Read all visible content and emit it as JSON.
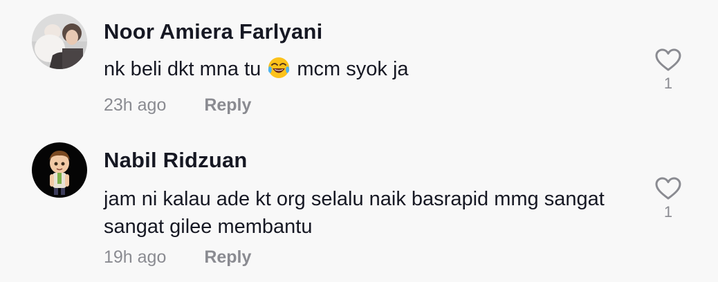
{
  "comments": [
    {
      "username": "Noor Amiera Farlyani",
      "text_before_emoji": "nk beli dkt mna tu ",
      "emoji_icon": "face-with-tears-of-joy-icon",
      "text_after_emoji": "  mcm syok ja",
      "time": "23h ago",
      "reply_label": "Reply",
      "likes": "1"
    },
    {
      "username": "Nabil Ridzuan",
      "text": "jam ni kalau ade kt org selalu naik basrapid mmg sangat sangat gilee membantu",
      "time": "19h ago",
      "reply_label": "Reply",
      "likes": "1"
    }
  ],
  "colors": {
    "background": "#f8f8f8",
    "primary_text": "#161823",
    "secondary_text": "#8a8b91"
  }
}
